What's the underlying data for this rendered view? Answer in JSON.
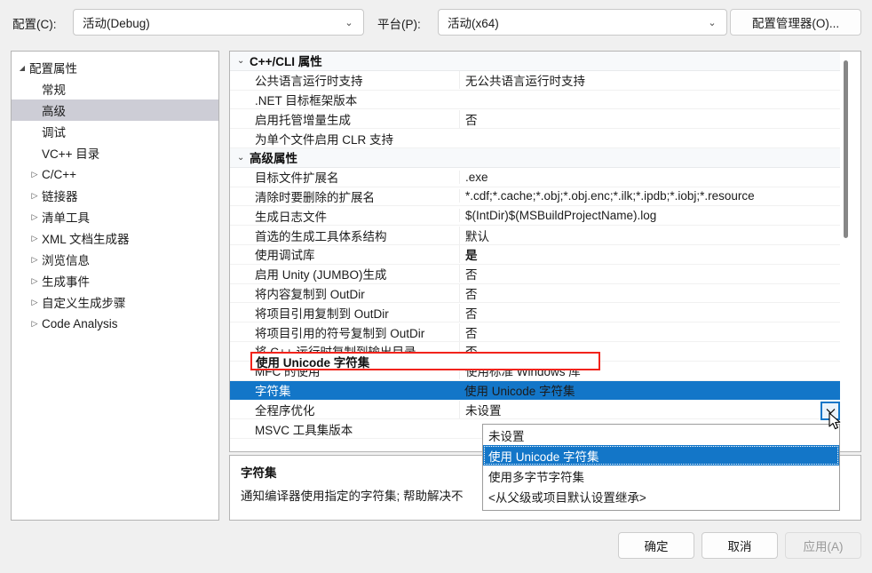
{
  "topbar": {
    "config_label": "配置(C):",
    "config_value": "活动(Debug)",
    "platform_label": "平台(P):",
    "platform_value": "活动(x64)",
    "config_manager_button": "配置管理器(O)...",
    "chevron": "⌄"
  },
  "tree": {
    "items": [
      {
        "label": "配置属性",
        "twist": "expanded",
        "indent": 0,
        "selected": false
      },
      {
        "label": "常规",
        "twist": "none",
        "indent": 1,
        "selected": false
      },
      {
        "label": "高级",
        "twist": "none",
        "indent": 1,
        "selected": true
      },
      {
        "label": "调试",
        "twist": "none",
        "indent": 1,
        "selected": false
      },
      {
        "label": "VC++ 目录",
        "twist": "none",
        "indent": 1,
        "selected": false
      },
      {
        "label": "C/C++",
        "twist": "collapsed",
        "indent": 1,
        "selected": false
      },
      {
        "label": "链接器",
        "twist": "collapsed",
        "indent": 1,
        "selected": false
      },
      {
        "label": "清单工具",
        "twist": "collapsed",
        "indent": 1,
        "selected": false
      },
      {
        "label": "XML 文档生成器",
        "twist": "collapsed",
        "indent": 1,
        "selected": false
      },
      {
        "label": "浏览信息",
        "twist": "collapsed",
        "indent": 1,
        "selected": false
      },
      {
        "label": "生成事件",
        "twist": "collapsed",
        "indent": 1,
        "selected": false
      },
      {
        "label": "自定义生成步骤",
        "twist": "collapsed",
        "indent": 1,
        "selected": false
      },
      {
        "label": "Code Analysis",
        "twist": "collapsed",
        "indent": 1,
        "selected": false
      }
    ]
  },
  "grid": {
    "rows": [
      {
        "kind": "category",
        "name": "C++/CLI 属性",
        "value": "",
        "chevron": "⌄"
      },
      {
        "kind": "prop",
        "name": "公共语言运行时支持",
        "value": "无公共语言运行时支持"
      },
      {
        "kind": "prop",
        "name": ".NET 目标框架版本",
        "value": ""
      },
      {
        "kind": "prop",
        "name": "启用托管增量生成",
        "value": "否"
      },
      {
        "kind": "prop",
        "name": "为单个文件启用 CLR 支持",
        "value": ""
      },
      {
        "kind": "category",
        "name": "高级属性",
        "value": "",
        "chevron": "⌄"
      },
      {
        "kind": "prop",
        "name": "目标文件扩展名",
        "value": ".exe"
      },
      {
        "kind": "prop",
        "name": "清除时要删除的扩展名",
        "value": "*.cdf;*.cache;*.obj;*.obj.enc;*.ilk;*.ipdb;*.iobj;*.resource"
      },
      {
        "kind": "prop",
        "name": "生成日志文件",
        "value": "$(IntDir)$(MSBuildProjectName).log"
      },
      {
        "kind": "prop",
        "name": "首选的生成工具体系结构",
        "value": "默认"
      },
      {
        "kind": "prop",
        "name": "使用调试库",
        "value": "是",
        "bold": true
      },
      {
        "kind": "prop",
        "name": "启用 Unity (JUMBO)生成",
        "value": "否"
      },
      {
        "kind": "prop",
        "name": "将内容复制到 OutDir",
        "value": "否"
      },
      {
        "kind": "prop",
        "name": "将项目引用复制到 OutDir",
        "value": "否"
      },
      {
        "kind": "prop",
        "name": "将项目引用的符号复制到 OutDir",
        "value": "否"
      },
      {
        "kind": "prop",
        "name": "将 C++ 运行时复制到输出目录",
        "value": "否"
      },
      {
        "kind": "prop",
        "name": "MFC 的使用",
        "value": "使用标准 Windows 库"
      },
      {
        "kind": "prop",
        "name": "字符集",
        "value": "使用 Unicode 字符集",
        "selected": true
      },
      {
        "kind": "prop",
        "name": "全程序优化",
        "value": "未设置"
      },
      {
        "kind": "prop",
        "name": "MSVC 工具集版本",
        "value": ""
      }
    ],
    "editor_value": "使用 Unicode 字符集",
    "highlight_color": "#f2231b",
    "selection_color": "#1376c8"
  },
  "dropdown": {
    "options": [
      {
        "label": "未设置",
        "highlighted": false
      },
      {
        "label": "使用 Unicode 字符集",
        "highlighted": true
      },
      {
        "label": "使用多字节字符集",
        "highlighted": false
      },
      {
        "label": "<从父级或项目默认设置继承>",
        "highlighted": false
      }
    ]
  },
  "description": {
    "title": "字符集",
    "body": "通知编译器使用指定的字符集; 帮助解决不"
  },
  "footer": {
    "ok": "确定",
    "cancel": "取消",
    "apply": "应用(A)"
  }
}
